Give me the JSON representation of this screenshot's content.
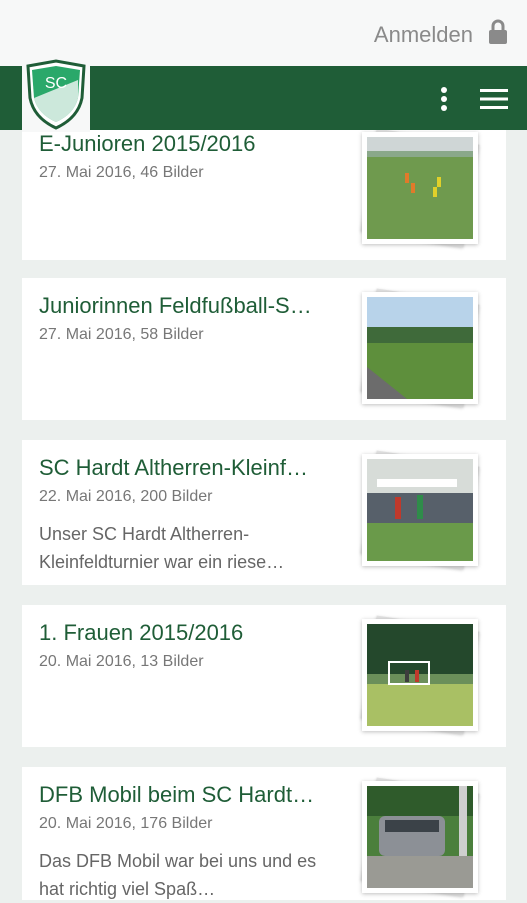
{
  "header": {
    "login_label": "Anmelden",
    "icons": {
      "lock": "lock-icon",
      "more": "more-vert-icon",
      "menu": "menu-icon"
    },
    "brand_color": "#1f5d37",
    "logo_text": "SC"
  },
  "galleries": [
    {
      "title": "E-Junioren 2015/2016",
      "meta": "27. Mai 2016, 46 Bilder",
      "description": ""
    },
    {
      "title": "Juniorinnen Feldfußball-S…",
      "meta": "27. Mai 2016, 58 Bilder",
      "description": ""
    },
    {
      "title": "SC Hardt Altherren-Kleinf…",
      "meta": "22. Mai 2016, 200 Bilder",
      "description": "Unser SC Hardt Altherren-Kleinfeldturnier war ein riese…"
    },
    {
      "title": "1. Frauen 2015/2016",
      "meta": "20. Mai 2016, 13 Bilder",
      "description": ""
    },
    {
      "title": "DFB Mobil beim SC Hardt…",
      "meta": "20. Mai 2016, 176 Bilder",
      "description": "Das DFB Mobil war bei uns und es hat richtig viel Spaß…"
    }
  ]
}
